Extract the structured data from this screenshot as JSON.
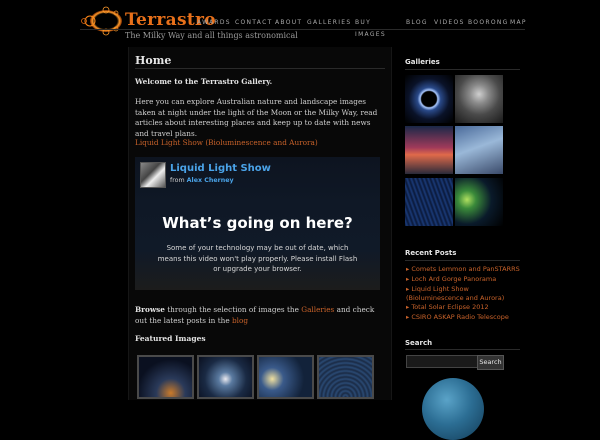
{
  "site": {
    "title": "Terrastro",
    "tagline": "The Milky Way and all things astronomical"
  },
  "nav": {
    "left": [
      "AWARDS",
      "CONTACT",
      "ABOUT",
      "GALLERIES",
      "BUY"
    ],
    "buy_sub": "IMAGES",
    "right": [
      "BLOG",
      "VIDEOS",
      "BOORONG",
      "MAP"
    ]
  },
  "main": {
    "page_title": "Home",
    "welcome": "Welcome to the Terrastro Gallery.",
    "intro": "Here you can explore Australian nature and landscape images taken at night under the light of the Moon or the Milky Way, read articles about interesting places and keep up to date with news and travel plans.",
    "video_link": "Liquid Light Show (Bioluminescence and Aurora)",
    "video": {
      "title": "Liquid Light Show",
      "from": "from",
      "author": "Alex Cherney",
      "headline": "What’s going on here?",
      "message": "Some of your technology may be out of date, which means this video won't play properly. Please install Flash or upgrade your browser."
    },
    "browse": {
      "lead": "Browse",
      "mid": " through the selection of images the ",
      "galleries_link": "Galleries",
      "tail": " and check out the latest posts in the ",
      "blog_link": "blog"
    },
    "featured_title": "Featured Images"
  },
  "sidebar": {
    "galleries_heading": "Galleries",
    "recent_heading": "Recent Posts",
    "recent_posts": [
      "Comets Lemmon and PanSTARRS",
      "Loch Ard Gorge Panorama",
      "Liquid Light Show (Bioluminescence and Aurora)",
      "Total Solar Eclipse 2012",
      "CSIRO ASKAP Radio Telescope"
    ],
    "search_heading": "Search",
    "search_button": "Search",
    "search_placeholder": ""
  },
  "colors": {
    "accent": "#e8701a",
    "link": "#c8622a",
    "video_title": "#4aa3e8",
    "background": "#000000"
  },
  "icons": {
    "logo": "fractal-logo-icon",
    "bullet": "triangle-bullet-icon"
  }
}
